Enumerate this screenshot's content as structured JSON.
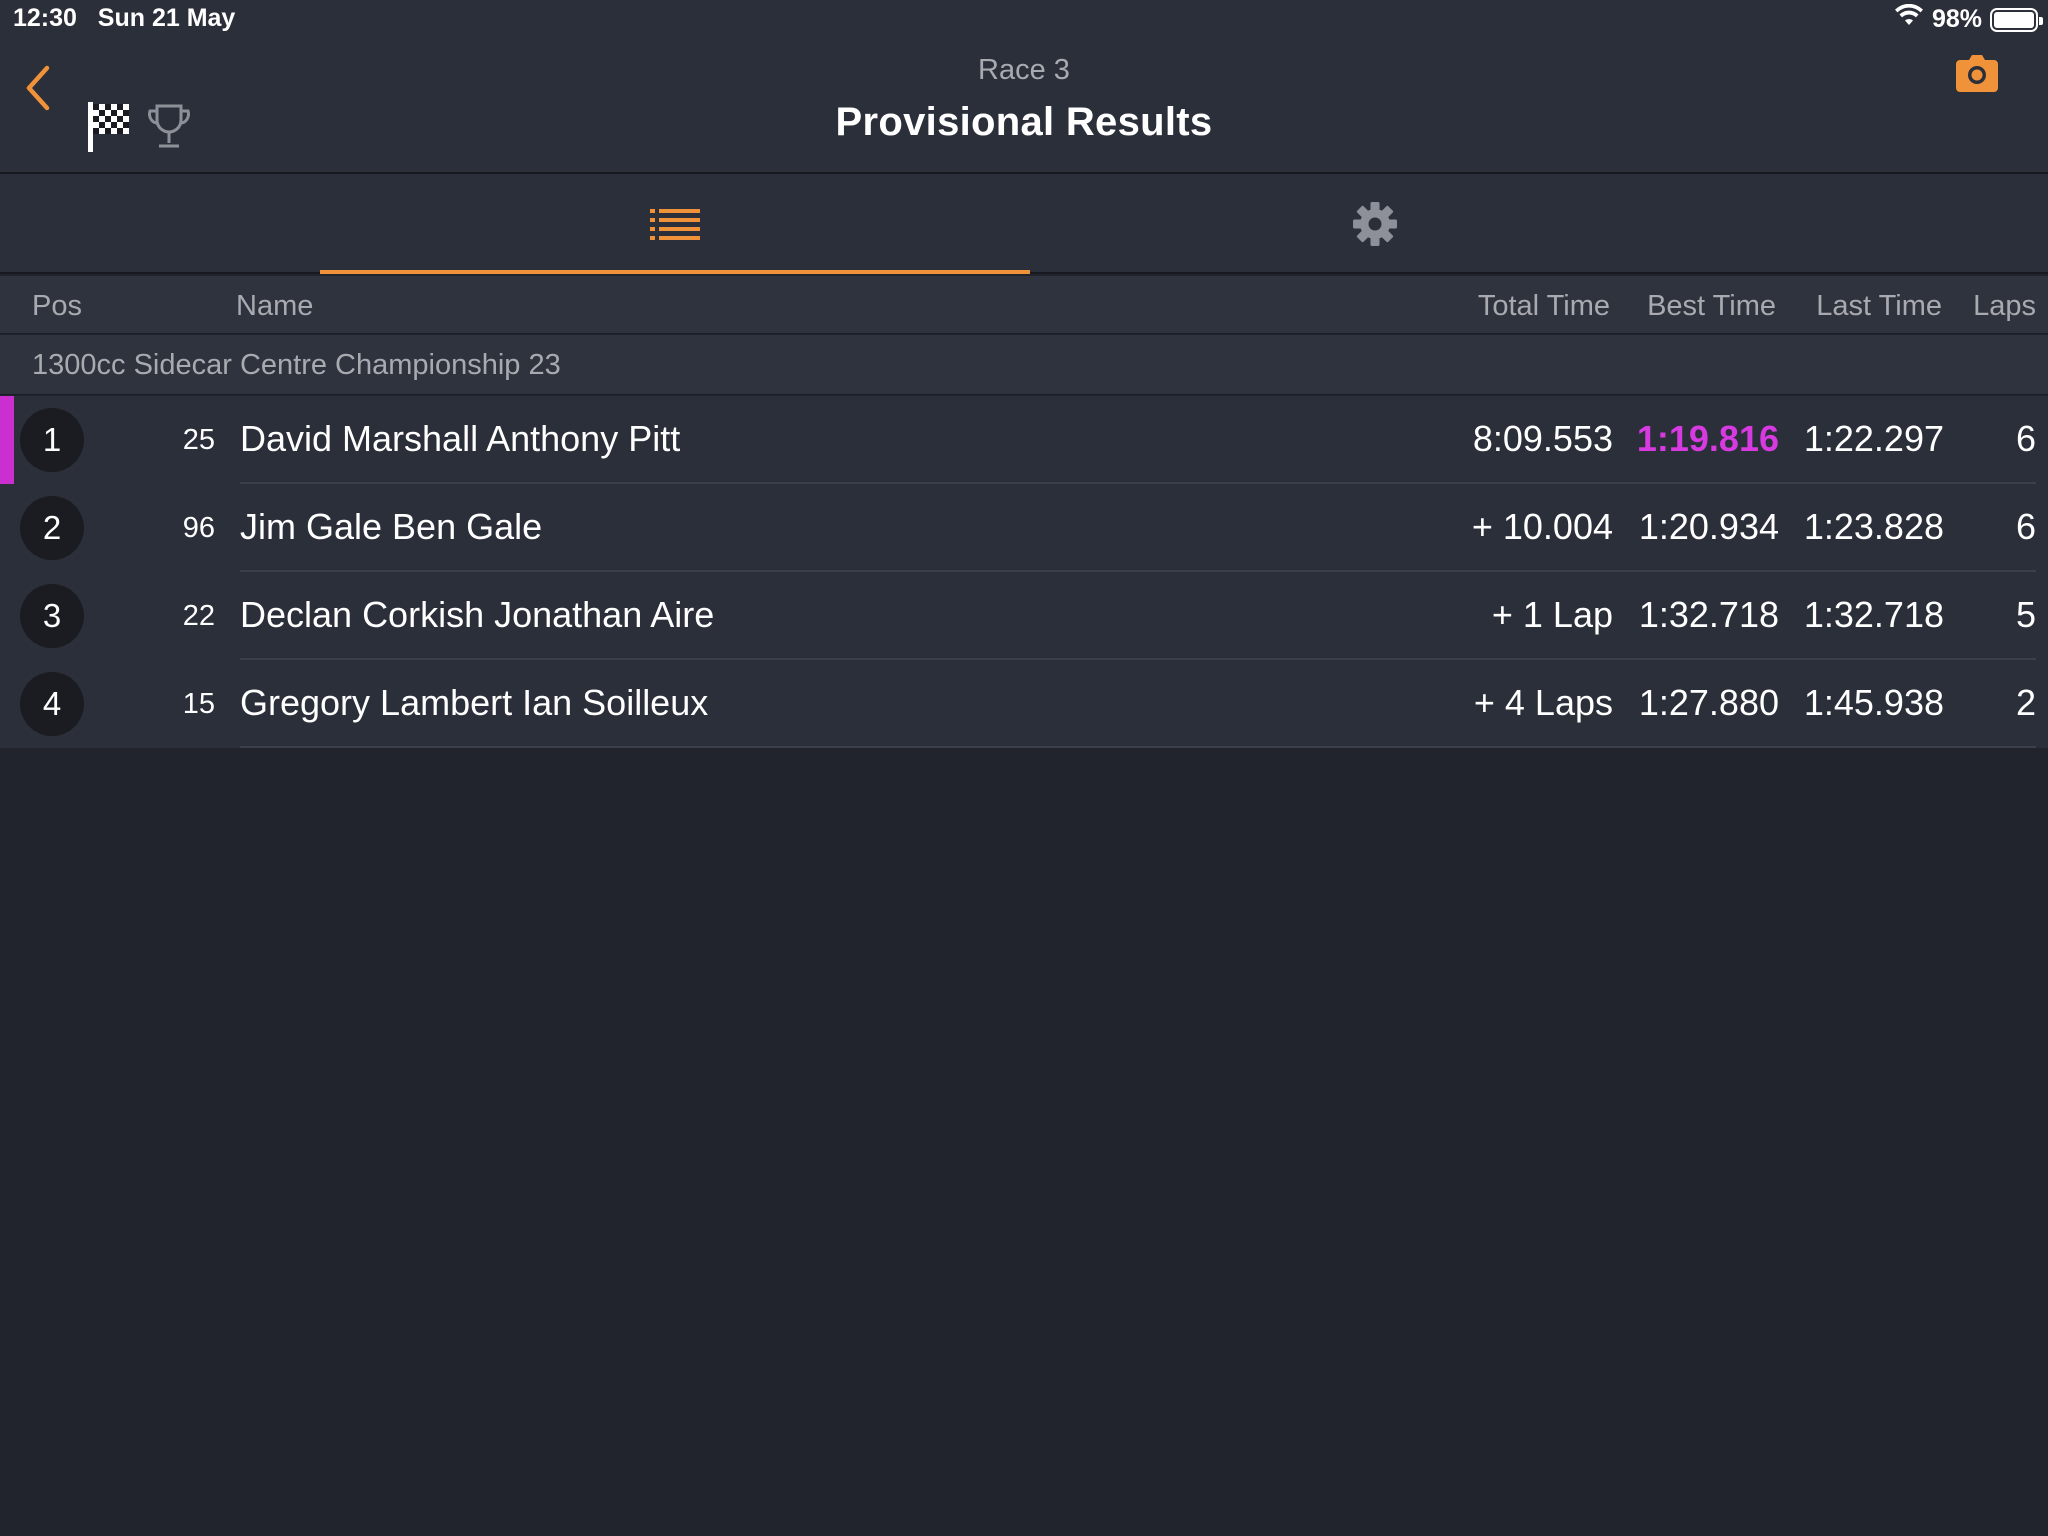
{
  "status_bar": {
    "time_date": "12:30   Sun 21 May",
    "battery_text": "98%",
    "wifi_icon": "wifi-icon",
    "battery_icon": "battery-icon"
  },
  "header": {
    "subtitle": "Race 3",
    "title": "Provisional Results",
    "accent_color": "#f0923a"
  },
  "tabs": [
    {
      "icon": "list-icon",
      "active": true
    },
    {
      "icon": "gear-icon",
      "active": false
    }
  ],
  "columns": {
    "pos": "Pos",
    "name": "Name",
    "total_time": "Total Time",
    "best_time": "Best Time",
    "last_time": "Last Time",
    "laps": "Laps"
  },
  "class_name": "1300cc Sidecar Centre Championship 23",
  "fastest_lap_color": "#d63ae0",
  "results": [
    {
      "pos": "1",
      "number": "25",
      "name": "David Marshall Anthony Pitt",
      "total_time": "8:09.553",
      "best_time": "1:19.816",
      "last_time": "1:22.297",
      "laps": "6"
    },
    {
      "pos": "2",
      "number": "96",
      "name": "Jim Gale Ben Gale",
      "total_time": "+ 10.004",
      "best_time": "1:20.934",
      "last_time": "1:23.828",
      "laps": "6"
    },
    {
      "pos": "3",
      "number": "22",
      "name": "Declan Corkish Jonathan Aire",
      "total_time": "+ 1 Lap",
      "best_time": "1:32.718",
      "last_time": "1:32.718",
      "laps": "5"
    },
    {
      "pos": "4",
      "number": "15",
      "name": "Gregory Lambert Ian Soilleux",
      "total_time": "+ 4 Laps",
      "best_time": "1:27.880",
      "last_time": "1:45.938",
      "laps": "2"
    }
  ]
}
